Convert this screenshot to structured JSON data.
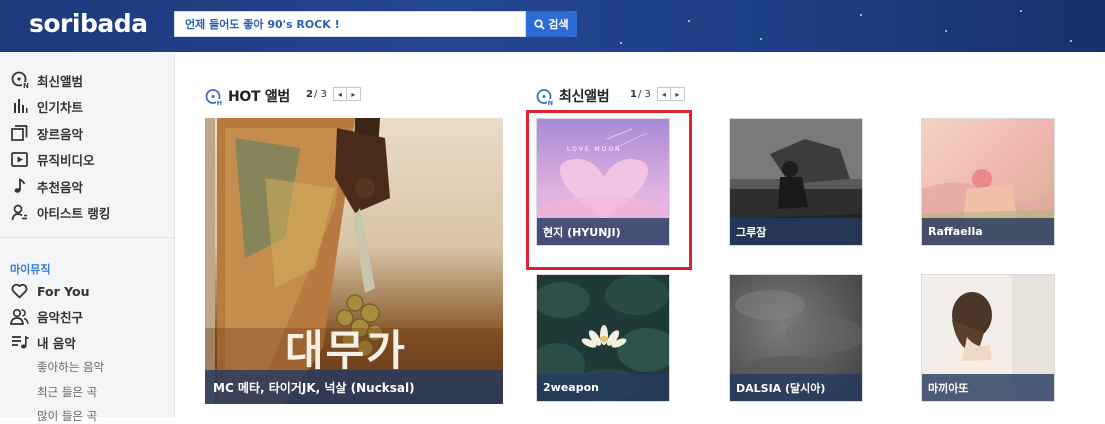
{
  "header": {
    "logo": "soribada",
    "search_value": "언제 들어도 좋아 90's ROCK !",
    "search_button": "검색"
  },
  "sidebar": {
    "items": [
      {
        "label": "최신앨범",
        "icon": "new-album-icon"
      },
      {
        "label": "인기차트",
        "icon": "chart-bars-icon"
      },
      {
        "label": "장르음악",
        "icon": "genre-icon"
      },
      {
        "label": "뮤직비디오",
        "icon": "video-play-icon"
      },
      {
        "label": "추천음악",
        "icon": "music-note-icon"
      },
      {
        "label": "아티스트 랭킹",
        "icon": "artist-icon"
      }
    ],
    "my_music_title": "마이뮤직",
    "my_items": [
      {
        "label": "For You",
        "icon": "heart-icon"
      },
      {
        "label": "음악친구",
        "icon": "friends-icon"
      },
      {
        "label": "내 음악",
        "icon": "playlist-icon"
      }
    ],
    "sub_items": [
      "좋아하는 음악",
      "최근 들은 곡",
      "많이 들은 곡"
    ]
  },
  "hot": {
    "title": "HOT 앨범",
    "page_current": "2",
    "page_total": "/ 3",
    "album": {
      "title": "MC 메타, 타이거JK, 넉살 (Nucksal)",
      "cover_text": "대무가"
    }
  },
  "latest": {
    "title": "최신앨범",
    "page_current": "1",
    "page_total": "/ 3",
    "albums": [
      {
        "title": "현지 (HYUNJI)",
        "cover_text": "LOVE MOON"
      },
      {
        "title": "그루잠"
      },
      {
        "title": "Raffaella"
      },
      {
        "title": "2weapon"
      },
      {
        "title": "DALSIA (달시아)"
      },
      {
        "title": "마끼아또"
      }
    ]
  },
  "colors": {
    "header_bg": "#1e3f86",
    "accent": "#2d6ad6",
    "highlight": "#e0232a"
  }
}
